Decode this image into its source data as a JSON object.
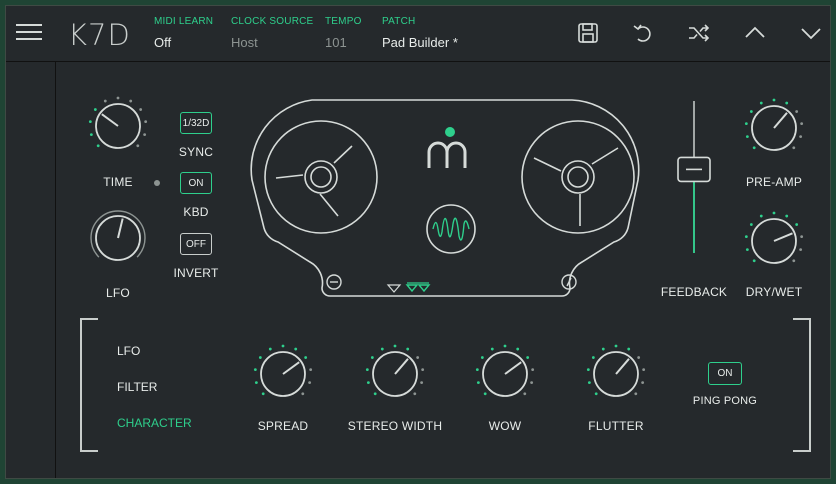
{
  "app": {
    "logo": "K7D"
  },
  "header": {
    "midi_learn": {
      "label": "MIDI LEARN",
      "value": "Off"
    },
    "clock_source": {
      "label": "CLOCK SOURCE",
      "value": "Host"
    },
    "tempo": {
      "label": "TEMPO",
      "value": "101"
    },
    "patch": {
      "label": "PATCH",
      "value": "Pad Builder *"
    }
  },
  "toolbar_icons": [
    "save-icon",
    "undo-icon",
    "shuffle-icon",
    "chevron-up-icon",
    "chevron-down-icon"
  ],
  "left_controls": {
    "time": {
      "label": "TIME",
      "value": 0.3
    },
    "lfo": {
      "label": "LFO",
      "value": 0.55
    },
    "sync": {
      "label": "SYNC",
      "button": "1/32D",
      "active": true
    },
    "kbd": {
      "label": "KBD",
      "button": "ON",
      "active": true
    },
    "invert": {
      "label": "INVERT",
      "button": "OFF",
      "active": false
    }
  },
  "right_controls": {
    "feedback": {
      "label": "FEEDBACK",
      "value": 0.55
    },
    "pre_amp": {
      "label": "PRE-AMP",
      "value": 0.65
    },
    "dry_wet": {
      "label": "DRY/WET",
      "value": 0.75
    }
  },
  "tabs": [
    {
      "label": "LFO",
      "active": false
    },
    {
      "label": "FILTER",
      "active": false
    },
    {
      "label": "CHARACTER",
      "active": true
    }
  ],
  "character": {
    "spread": {
      "label": "SPREAD",
      "value": 0.7
    },
    "stereo_width": {
      "label": "STEREO WIDTH",
      "value": 0.65
    },
    "wow": {
      "label": "WOW",
      "value": 0.7
    },
    "flutter": {
      "label": "FLUTTER",
      "value": 0.65
    },
    "ping_pong": {
      "label": "PING PONG",
      "button": "ON",
      "active": true
    }
  },
  "colors": {
    "accent": "#2ecf8c",
    "panel": "#25292c",
    "background": "#1f4434",
    "line": "#d6dbd9"
  }
}
